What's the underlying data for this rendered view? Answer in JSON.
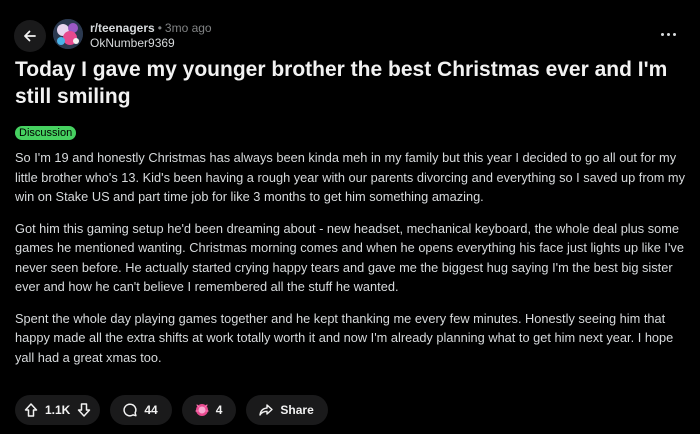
{
  "post": {
    "subreddit": "r/teenagers",
    "separator": "•",
    "age": "3mo ago",
    "author": "OkNumber9369",
    "title": "Today I gave my younger brother the best Christmas ever and I'm still smiling",
    "flair": "Discussion",
    "body": [
      "So I'm 19 and honestly Christmas has always been kinda meh in my family but this year I decided to go all out for my little brother who's 13. Kid's been having a rough year with our parents divorcing and everything so I saved up from my win on Stake US and part time job for like 3 months to get him something amazing.",
      "Got him this gaming setup he'd been dreaming about - new headset, mechanical keyboard, the whole deal plus some games he mentioned wanting. Christmas morning comes and when he opens everything his face just lights up like I've never seen before. He actually started crying happy tears and gave me the biggest hug saying I'm the best big sister ever and how he can't believe I remembered all the stuff he wanted.",
      "Spent the whole day playing games together and he kept thanking me every few minutes. Honestly seeing him that happy made all the extra shifts at work totally worth it and now I'm already planning what to get him next year. I hope yall had a great xmas too."
    ]
  },
  "actions": {
    "votes": "1.1K",
    "comments": "44",
    "awards": "4",
    "share": "Share"
  },
  "icons": {
    "back": "arrow-left-icon",
    "more": "more-horizontal-icon",
    "upvote": "arrow-up-icon",
    "downvote": "arrow-down-icon",
    "comment": "comment-bubble-icon",
    "award": "award-icon",
    "share": "share-arrow-icon"
  },
  "colors": {
    "background": "#000000",
    "flair": "#46d160",
    "pill": "#1a1a1b",
    "text": "#d7dadc"
  }
}
